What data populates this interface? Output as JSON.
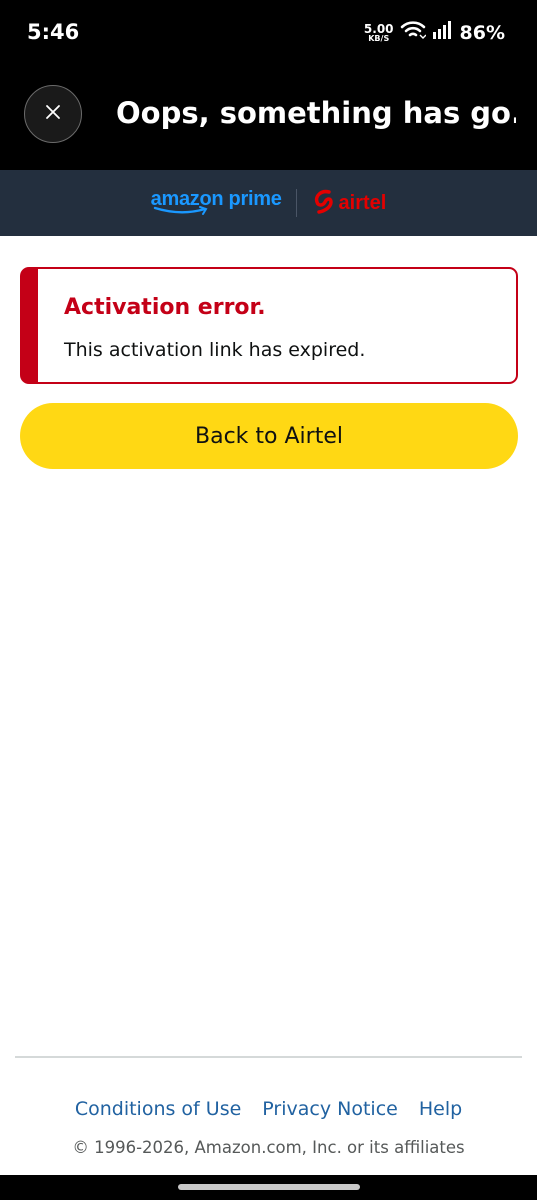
{
  "status_bar": {
    "time": "5:46",
    "net_speed_value": "5.00",
    "net_speed_unit": "KB/S",
    "battery": "86%",
    "icons": [
      "wifi-icon",
      "signal-icon"
    ]
  },
  "header": {
    "title": "Oops, something has go...",
    "close_icon": "close-icon"
  },
  "brand": {
    "prime_text": "amazon prime",
    "airtel_text": "airtel",
    "colors": {
      "bar_background": "#232f3e",
      "prime_blue": "#1a98ff",
      "airtel_red": "#e40000"
    }
  },
  "alert": {
    "title": "Activation error.",
    "message": "This activation link has expired.",
    "color": "#c40017"
  },
  "back_button": {
    "label": "Back to Airtel",
    "color": "#ffd814"
  },
  "footer": {
    "links": [
      "Conditions of Use",
      "Privacy Notice",
      "Help"
    ],
    "copyright": "© 1996-2026, Amazon.com, Inc. or its affiliates",
    "link_color": "#2162a1"
  }
}
